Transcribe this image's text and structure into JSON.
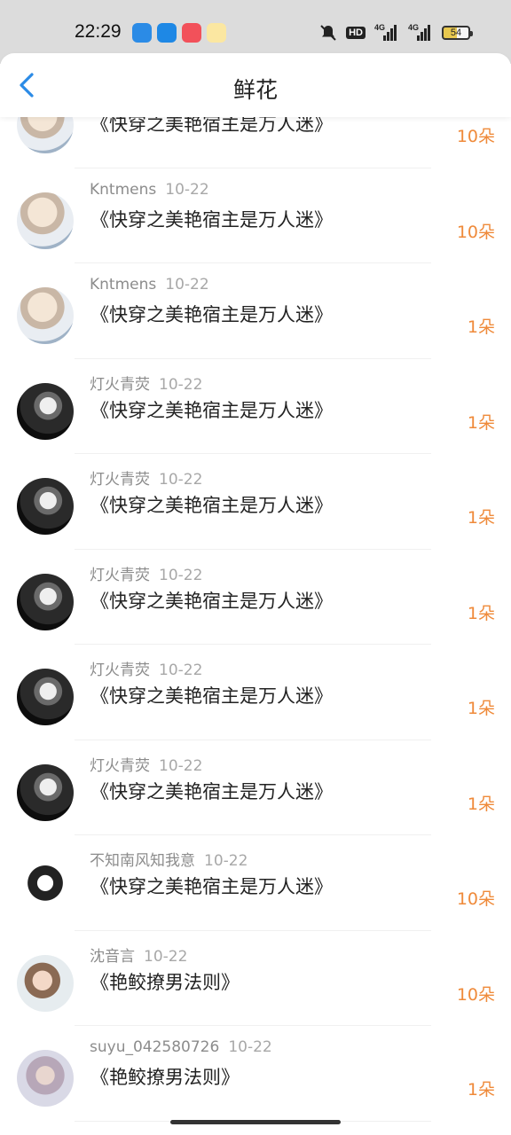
{
  "status_bar": {
    "time": "22:29",
    "apps": [
      {
        "name": "browser-app-icon",
        "color": "#2b8be6"
      },
      {
        "name": "circle-app-icon",
        "color": "#2196f3"
      },
      {
        "name": "music-app-icon",
        "color": "#f2515a"
      },
      {
        "name": "weibo-app-icon",
        "color": "#e6162d"
      }
    ],
    "hd_label": "HD",
    "net1": "4G",
    "net2": "4G",
    "battery": "54"
  },
  "nav": {
    "title": "鲜花",
    "back_icon": "chevron-left-icon",
    "accent": "#2b8be6"
  },
  "list": [
    {
      "user": "",
      "date": "",
      "book": "《快穿之美艳宿主是万人迷》",
      "amount": "10朵",
      "avatar": "light"
    },
    {
      "user": "Kntmens",
      "date": "10-22",
      "book": "《快穿之美艳宿主是万人迷》",
      "amount": "10朵",
      "avatar": "light"
    },
    {
      "user": "Kntmens",
      "date": "10-22",
      "book": "《快穿之美艳宿主是万人迷》",
      "amount": "1朵",
      "avatar": "light"
    },
    {
      "user": "灯火青荧",
      "date": "10-22",
      "book": "《快穿之美艳宿主是万人迷》",
      "amount": "1朵",
      "avatar": "dark"
    },
    {
      "user": "灯火青荧",
      "date": "10-22",
      "book": "《快穿之美艳宿主是万人迷》",
      "amount": "1朵",
      "avatar": "dark"
    },
    {
      "user": "灯火青荧",
      "date": "10-22",
      "book": "《快穿之美艳宿主是万人迷》",
      "amount": "1朵",
      "avatar": "dark"
    },
    {
      "user": "灯火青荧",
      "date": "10-22",
      "book": "《快穿之美艳宿主是万人迷》",
      "amount": "1朵",
      "avatar": "dark"
    },
    {
      "user": "灯火青荧",
      "date": "10-22",
      "book": "《快穿之美艳宿主是万人迷》",
      "amount": "1朵",
      "avatar": "dark"
    },
    {
      "user": "不知南风知我意",
      "date": "10-22",
      "book": "《快穿之美艳宿主是万人迷》",
      "amount": "10朵",
      "avatar": "black"
    },
    {
      "user": "沈音言",
      "date": "10-22",
      "book": "《艳鲛撩男法则》",
      "amount": "10朵",
      "avatar": "anime"
    },
    {
      "user": "suyu_042580726",
      "date": "10-22",
      "book": "《艳鲛撩男法则》",
      "amount": "1朵",
      "avatar": "blur"
    }
  ]
}
